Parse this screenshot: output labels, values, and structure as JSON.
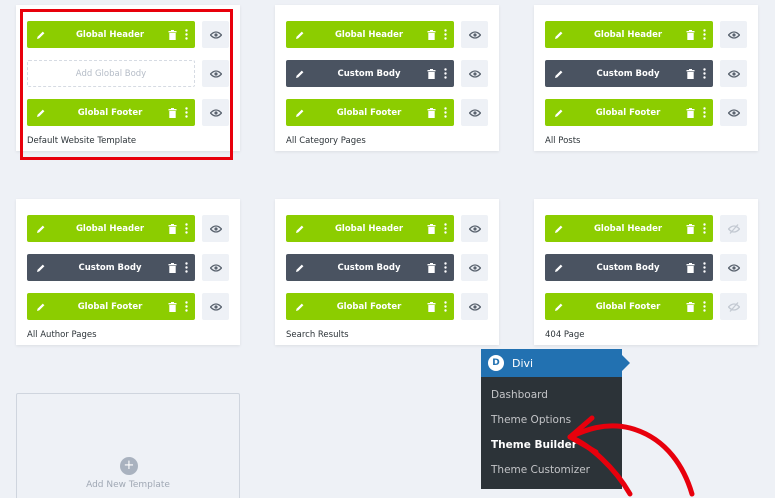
{
  "templates": [
    {
      "name": "Default Website Template",
      "header": {
        "label": "Global Header",
        "style": "green"
      },
      "body": {
        "label": "Add Global Body",
        "style": "add"
      },
      "footer": {
        "label": "Global Footer",
        "style": "green"
      },
      "visibility": [
        "eye",
        "eye",
        "eye"
      ]
    },
    {
      "name": "All Category Pages",
      "header": {
        "label": "Global Header",
        "style": "green"
      },
      "body": {
        "label": "Custom Body",
        "style": "dark"
      },
      "footer": {
        "label": "Global Footer",
        "style": "green"
      },
      "visibility": [
        "eye",
        "eye",
        "eye"
      ]
    },
    {
      "name": "All Posts",
      "header": {
        "label": "Global Header",
        "style": "green"
      },
      "body": {
        "label": "Custom Body",
        "style": "dark"
      },
      "footer": {
        "label": "Global Footer",
        "style": "green"
      },
      "visibility": [
        "eye",
        "eye",
        "eye"
      ]
    },
    {
      "name": "All Author Pages",
      "header": {
        "label": "Global Header",
        "style": "green"
      },
      "body": {
        "label": "Custom Body",
        "style": "dark"
      },
      "footer": {
        "label": "Global Footer",
        "style": "green"
      },
      "visibility": [
        "eye",
        "eye",
        "eye"
      ]
    },
    {
      "name": "Search Results",
      "header": {
        "label": "Global Header",
        "style": "green"
      },
      "body": {
        "label": "Custom Body",
        "style": "dark"
      },
      "footer": {
        "label": "Global Footer",
        "style": "green"
      },
      "visibility": [
        "eye",
        "eye",
        "eye"
      ]
    },
    {
      "name": "404 Page",
      "header": {
        "label": "Global Header",
        "style": "green"
      },
      "body": {
        "label": "Custom Body",
        "style": "dark"
      },
      "footer": {
        "label": "Global Footer",
        "style": "green"
      },
      "visibility": [
        "eye-slash",
        "eye",
        "eye-slash"
      ]
    }
  ],
  "add_new": {
    "label": "Add New Template"
  },
  "menu": {
    "title": "Divi",
    "logo": "D",
    "items": [
      {
        "label": "Dashboard"
      },
      {
        "label": "Theme Options"
      },
      {
        "label": "Theme Builder",
        "active": true
      },
      {
        "label": "Theme Customizer"
      }
    ]
  },
  "colors": {
    "green": "#8ccd00",
    "dark": "#4a5361",
    "highlight": "#e8000c",
    "menu_bg": "#2c3338",
    "menu_head": "#2271b1"
  }
}
